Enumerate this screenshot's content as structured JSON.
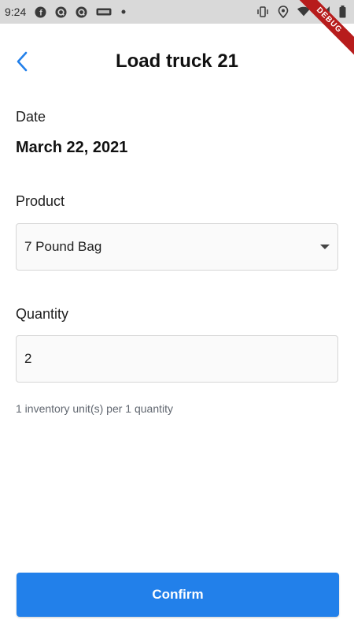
{
  "status_bar": {
    "time": "9:24",
    "left_icons": [
      "facebook-icon",
      "q-app-icon",
      "q-app-icon",
      "sms-icon",
      "dot-icon"
    ],
    "right_icons": [
      "vibrate-icon",
      "location-icon",
      "wifi-icon",
      "signal-icon",
      "battery-icon"
    ]
  },
  "debug_banner": "DEBUG",
  "app_bar": {
    "back_icon": "chevron-left-icon",
    "title": "Load truck 21"
  },
  "date": {
    "label": "Date",
    "value": "March 22, 2021"
  },
  "product": {
    "label": "Product",
    "selected": "7 Pound Bag",
    "icon": "dropdown-arrow-icon"
  },
  "quantity": {
    "label": "Quantity",
    "value": "2",
    "helper": "1 inventory unit(s) per 1 quantity"
  },
  "confirm_button": {
    "label": "Confirm"
  },
  "colors": {
    "accent": "#2280ea",
    "back_icon": "#2280ea",
    "status_bar": "#d9d9d9",
    "debug_ribbon": "#b71c1c"
  }
}
